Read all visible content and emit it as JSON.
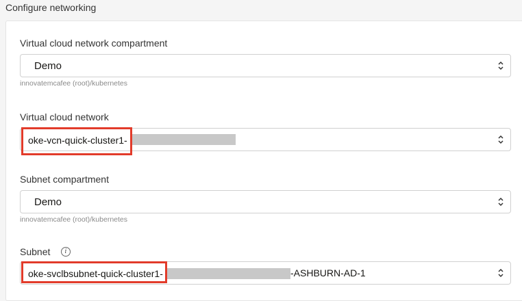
{
  "section": {
    "title": "Configure networking"
  },
  "fields": {
    "vcn_compartment": {
      "label": "Virtual cloud network compartment",
      "value": "Demo",
      "helper": "innovatemcafee (root)/kubernetes"
    },
    "vcn": {
      "label": "Virtual cloud network",
      "value": "oke-vcn-quick-cluster1-"
    },
    "subnet_compartment": {
      "label": "Subnet compartment",
      "value": "Demo",
      "helper": "innovatemcafee (root)/kubernetes"
    },
    "subnet": {
      "label": "Subnet",
      "value": "oke-svclbsubnet-quick-cluster1-",
      "value_suffix": "-ASHBURN-AD-1",
      "info_icon": "i"
    }
  },
  "colors": {
    "highlight": "#e23b2a",
    "redaction": "#c8c8c8"
  },
  "icons": [
    "chevron-up-down-icon",
    "info-icon"
  ]
}
